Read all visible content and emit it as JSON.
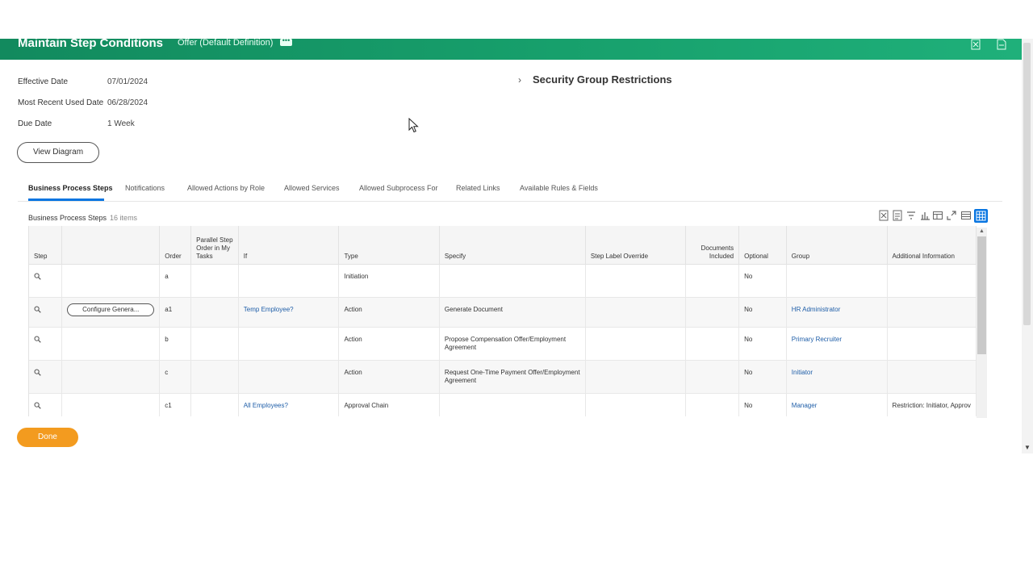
{
  "header": {
    "title": "Maintain Step Conditions",
    "subtitle": "Offer (Default Definition)",
    "related_actions_icon": "ellipsis-icon",
    "export_excel_icon": "excel-export-icon",
    "export_pdf_icon": "pdf-export-icon",
    "gradient_colors": [
      "#128a5e",
      "#1fb07a"
    ]
  },
  "meta": [
    {
      "label": "Effective Date",
      "value": "07/01/2024"
    },
    {
      "label": "Most Recent Used Date",
      "value": "06/28/2024"
    },
    {
      "label": "Due Date",
      "value": "1 Week"
    }
  ],
  "view_diagram_label": "View Diagram",
  "security_group_restrictions": "Security Group Restrictions",
  "tabs": [
    {
      "label": "Business Process Steps",
      "active": true
    },
    {
      "label": "Notifications"
    },
    {
      "label": "Allowed Actions by Role"
    },
    {
      "label": "Allowed Services"
    },
    {
      "label": "Allowed Subprocess For"
    },
    {
      "label": "Related Links"
    },
    {
      "label": "Available Rules & Fields"
    }
  ],
  "grid": {
    "title": "Business Process Steps",
    "count": "16 items",
    "columns": [
      "Step",
      "",
      "Order",
      "Parallel Step Order in My Tasks",
      "If",
      "Type",
      "Specify",
      "Step Label Override",
      "Documents Included",
      "Optional",
      "Group",
      "Additional Information"
    ],
    "rows": [
      {
        "button": "",
        "order": "a",
        "parallel": "",
        "if": "",
        "type": "Initiation",
        "specify": "",
        "label_override": "",
        "documents": "",
        "optional": "No",
        "group": "",
        "additional": ""
      },
      {
        "button": "Configure Genera...",
        "order": "a1",
        "parallel": "",
        "if": "Temp Employee?",
        "type": "Action",
        "specify": "Generate Document",
        "label_override": "",
        "documents": "",
        "optional": "No",
        "group": "HR Administrator",
        "additional": ""
      },
      {
        "button": "",
        "order": "b",
        "parallel": "",
        "if": "",
        "type": "Action",
        "specify": "Propose Compensation Offer/Employment Agreement",
        "label_override": "",
        "documents": "",
        "optional": "No",
        "group": "Primary Recruiter",
        "additional": ""
      },
      {
        "button": "",
        "order": "c",
        "parallel": "",
        "if": "",
        "type": "Action",
        "specify": "Request One-Time Payment Offer/Employment Agreement",
        "label_override": "",
        "documents": "",
        "optional": "No",
        "group": "Initiator",
        "additional": ""
      },
      {
        "button": "",
        "order": "c1",
        "parallel": "",
        "if": "All Employees?",
        "type": "Approval Chain",
        "specify": "",
        "label_override": "",
        "documents": "",
        "optional": "No",
        "group": "Manager",
        "additional": "Restriction: Initiator, Approv"
      }
    ]
  },
  "done_label": "Done",
  "accent_color": "#0875e1",
  "done_color": "#f39b1f",
  "link_color": "#1f5ea8"
}
